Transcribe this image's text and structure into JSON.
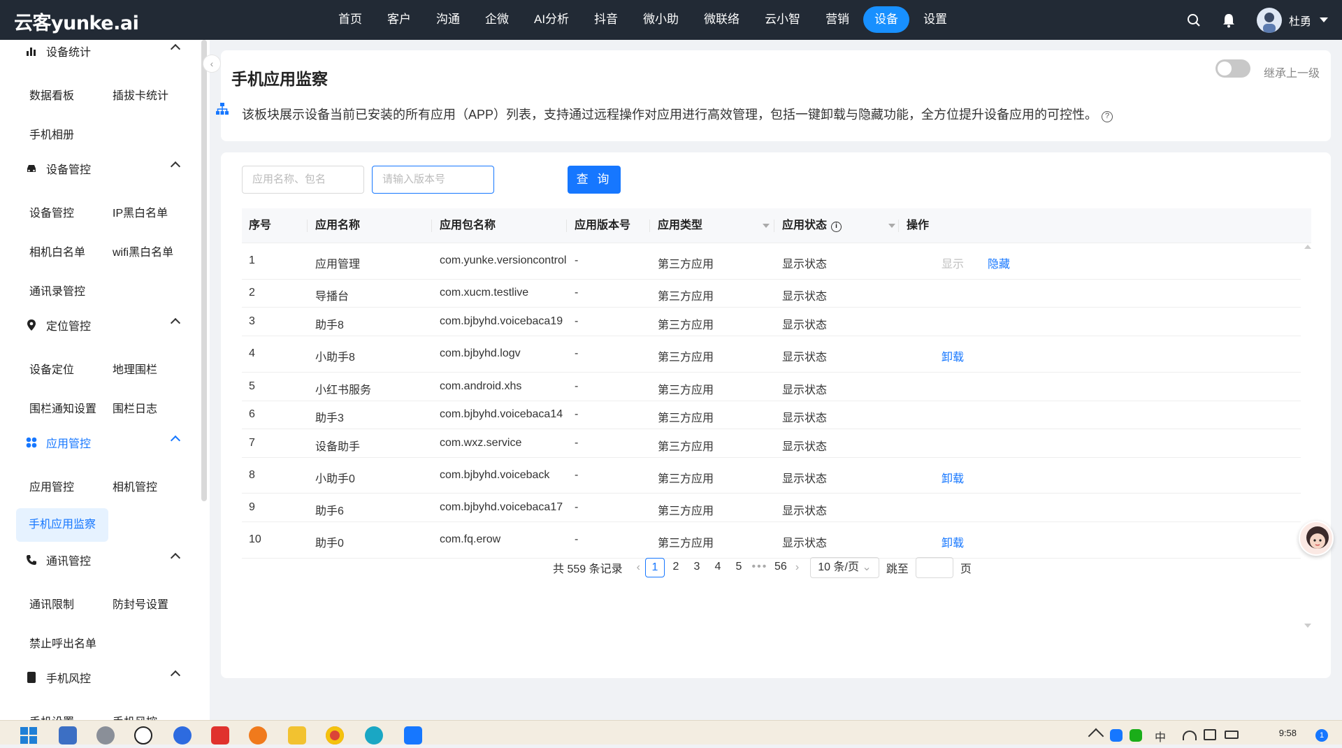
{
  "header": {
    "logo": "云客yunke.ai",
    "nav": [
      "首页",
      "客户",
      "沟通",
      "企微",
      "AI分析",
      "抖音",
      "微小助",
      "微联络",
      "云小智",
      "营销",
      "设备",
      "设置"
    ],
    "active_nav": "设备",
    "user_name": "杜勇"
  },
  "sidebar": {
    "groups": [
      {
        "title": "设备统计",
        "icon": "bar-chart-icon",
        "items": [
          "数据看板",
          "插拔卡统计",
          "手机相册"
        ]
      },
      {
        "title": "设备管控",
        "icon": "car-icon",
        "items": [
          "设备管控",
          "IP黑白名单",
          "相机白名单",
          "wifi黑白名单",
          "通讯录管控"
        ]
      },
      {
        "title": "定位管控",
        "icon": "location-pin-icon",
        "items": [
          "设备定位",
          "地理围栏",
          "围栏通知设置",
          "围栏日志"
        ]
      },
      {
        "title": "应用管控",
        "icon": "apps-icon",
        "items": [
          "应用管控",
          "相机管控",
          "手机应用监察"
        ]
      },
      {
        "title": "通讯管控",
        "icon": "phone-icon",
        "items": [
          "通讯限制",
          "防封号设置",
          "禁止呼出名单"
        ]
      },
      {
        "title": "手机风控",
        "icon": "phone-device-icon",
        "items": [
          "手机设置",
          "手机风控"
        ]
      }
    ],
    "active_group": "应用管控",
    "active_item": "手机应用监察"
  },
  "page": {
    "title": "手机应用监察",
    "inherit_label": "继承上一级",
    "inherit_on": false,
    "description": "该板块展示设备当前已安装的所有应用（APP）列表，支持通过远程操作对应用进行高效管理，包括一键卸载与隐藏功能，全方位提升设备应用的可控性。"
  },
  "filters": {
    "app_name_placeholder": "应用名称、包名",
    "version_placeholder": "请输入版本号",
    "query_button": "查 询"
  },
  "table": {
    "columns": [
      "序号",
      "应用名称",
      "应用包名称",
      "应用版本号",
      "应用类型",
      "应用状态",
      "操作"
    ],
    "rows": [
      {
        "no": "1",
        "name": "应用管理",
        "pkg": "com.yunke.versioncontrol",
        "ver": "-",
        "type": "第三方应用",
        "status": "显示状态",
        "actions": [
          "显示",
          "隐藏"
        ]
      },
      {
        "no": "2",
        "name": "导播台",
        "pkg": "com.xucm.testlive",
        "ver": "-",
        "type": "第三方应用",
        "status": "显示状态",
        "actions": []
      },
      {
        "no": "3",
        "name": "助手8",
        "pkg": "com.bjbyhd.voicebaca19",
        "ver": "-",
        "type": "第三方应用",
        "status": "显示状态",
        "actions": []
      },
      {
        "no": "4",
        "name": "小助手8",
        "pkg": "com.bjbyhd.logv",
        "ver": "-",
        "type": "第三方应用",
        "status": "显示状态",
        "actions": [
          "卸载"
        ]
      },
      {
        "no": "5",
        "name": "小红书服务",
        "pkg": "com.android.xhs",
        "ver": "-",
        "type": "第三方应用",
        "status": "显示状态",
        "actions": []
      },
      {
        "no": "6",
        "name": "助手3",
        "pkg": "com.bjbyhd.voicebaca14",
        "ver": "-",
        "type": "第三方应用",
        "status": "显示状态",
        "actions": []
      },
      {
        "no": "7",
        "name": "设备助手",
        "pkg": "com.wxz.service",
        "ver": "-",
        "type": "第三方应用",
        "status": "显示状态",
        "actions": []
      },
      {
        "no": "8",
        "name": "小助手0",
        "pkg": "com.bjbyhd.voiceback",
        "ver": "-",
        "type": "第三方应用",
        "status": "显示状态",
        "actions": [
          "卸载"
        ]
      },
      {
        "no": "9",
        "name": "助手6",
        "pkg": "com.bjbyhd.voicebaca17",
        "ver": "-",
        "type": "第三方应用",
        "status": "显示状态",
        "actions": []
      },
      {
        "no": "10",
        "name": "助手0",
        "pkg": "com.fq.erow",
        "ver": "-",
        "type": "第三方应用",
        "status": "显示状态",
        "actions": [
          "卸载"
        ]
      }
    ]
  },
  "pagination": {
    "total": "共 559 条记录",
    "pages": [
      "1",
      "2",
      "3",
      "4",
      "5",
      "•••",
      "56"
    ],
    "current": "1",
    "page_size": "10 条/页",
    "jump_label": "跳至",
    "page_unit": "页"
  },
  "taskbar": {
    "time": "9:58",
    "ime": "中",
    "notify_count": "1"
  }
}
